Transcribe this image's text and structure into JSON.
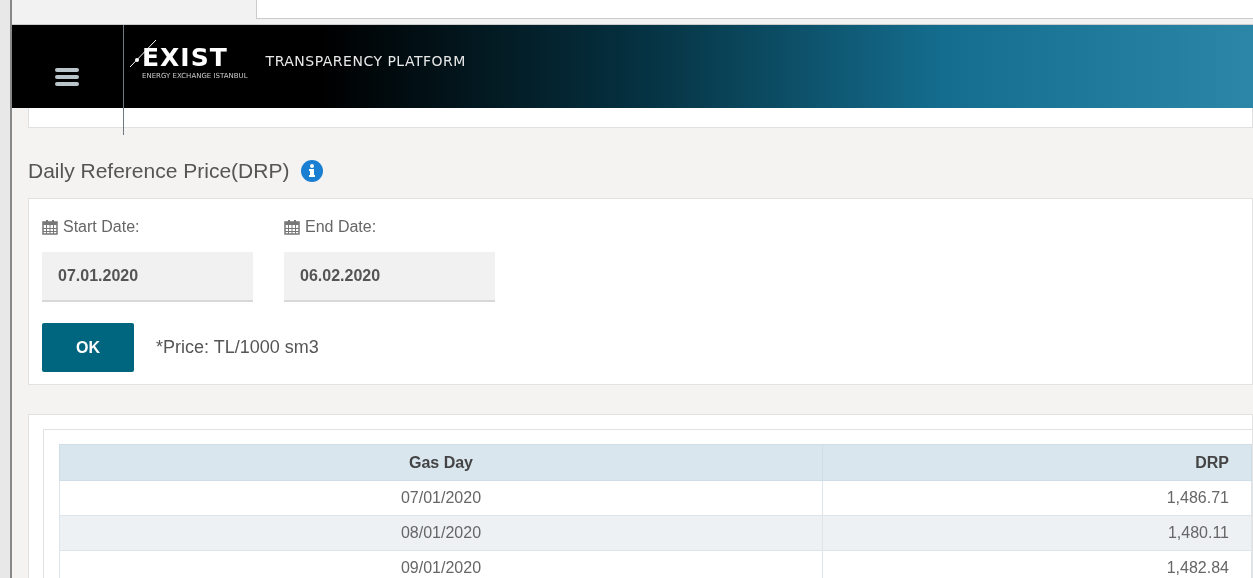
{
  "header": {
    "logo": "EXIST",
    "logo_subtitle": "ENERGY EXCHANGE ISTANBUL",
    "platform": "TRANSPARENCY PLATFORM"
  },
  "page_title": "Daily Reference Price(DRP)",
  "filters": [
    {
      "label": "Start Date:",
      "value": "07.01.2020"
    },
    {
      "label": "End Date:",
      "value": "06.02.2020"
    }
  ],
  "ok_button": "OK",
  "note": "*Price: TL/1000 sm3",
  "table": {
    "columns": [
      "Gas Day",
      "DRP"
    ],
    "rows": [
      [
        "07/01/2020",
        "1,486.71"
      ],
      [
        "08/01/2020",
        "1,480.11"
      ],
      [
        "09/01/2020",
        "1,482.84"
      ]
    ]
  }
}
